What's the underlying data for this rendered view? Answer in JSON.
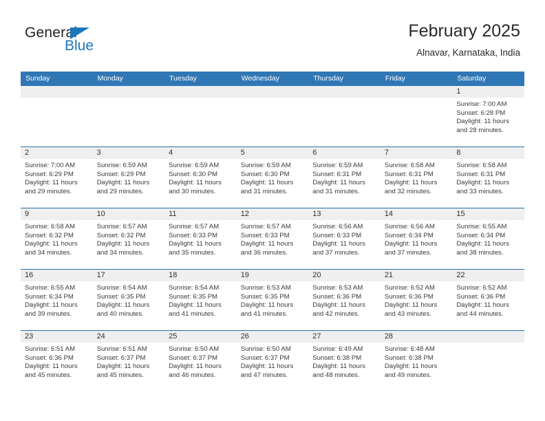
{
  "brand": {
    "name_dark": "General",
    "name_blue": "Blue",
    "accent_color": "#1b76bc"
  },
  "header": {
    "title": "February 2025",
    "subtitle": "Alnavar, Karnataka, India",
    "header_bg_color": "#3077b5",
    "daynum_band_color": "#efefef"
  },
  "weekday_headers": [
    "Sunday",
    "Monday",
    "Tuesday",
    "Wednesday",
    "Thursday",
    "Friday",
    "Saturday"
  ],
  "weeks": [
    [
      {
        "day": "",
        "empty": true
      },
      {
        "day": "",
        "empty": true
      },
      {
        "day": "",
        "empty": true
      },
      {
        "day": "",
        "empty": true
      },
      {
        "day": "",
        "empty": true
      },
      {
        "day": "",
        "empty": true
      },
      {
        "day": "1",
        "sunrise": "Sunrise: 7:00 AM",
        "sunset": "Sunset: 6:28 PM",
        "daylight1": "Daylight: 11 hours",
        "daylight2": "and 28 minutes."
      }
    ],
    [
      {
        "day": "2",
        "sunrise": "Sunrise: 7:00 AM",
        "sunset": "Sunset: 6:29 PM",
        "daylight1": "Daylight: 11 hours",
        "daylight2": "and 29 minutes."
      },
      {
        "day": "3",
        "sunrise": "Sunrise: 6:59 AM",
        "sunset": "Sunset: 6:29 PM",
        "daylight1": "Daylight: 11 hours",
        "daylight2": "and 29 minutes."
      },
      {
        "day": "4",
        "sunrise": "Sunrise: 6:59 AM",
        "sunset": "Sunset: 6:30 PM",
        "daylight1": "Daylight: 11 hours",
        "daylight2": "and 30 minutes."
      },
      {
        "day": "5",
        "sunrise": "Sunrise: 6:59 AM",
        "sunset": "Sunset: 6:30 PM",
        "daylight1": "Daylight: 11 hours",
        "daylight2": "and 31 minutes."
      },
      {
        "day": "6",
        "sunrise": "Sunrise: 6:59 AM",
        "sunset": "Sunset: 6:31 PM",
        "daylight1": "Daylight: 11 hours",
        "daylight2": "and 31 minutes."
      },
      {
        "day": "7",
        "sunrise": "Sunrise: 6:58 AM",
        "sunset": "Sunset: 6:31 PM",
        "daylight1": "Daylight: 11 hours",
        "daylight2": "and 32 minutes."
      },
      {
        "day": "8",
        "sunrise": "Sunrise: 6:58 AM",
        "sunset": "Sunset: 6:31 PM",
        "daylight1": "Daylight: 11 hours",
        "daylight2": "and 33 minutes."
      }
    ],
    [
      {
        "day": "9",
        "sunrise": "Sunrise: 6:58 AM",
        "sunset": "Sunset: 6:32 PM",
        "daylight1": "Daylight: 11 hours",
        "daylight2": "and 34 minutes."
      },
      {
        "day": "10",
        "sunrise": "Sunrise: 6:57 AM",
        "sunset": "Sunset: 6:32 PM",
        "daylight1": "Daylight: 11 hours",
        "daylight2": "and 34 minutes."
      },
      {
        "day": "11",
        "sunrise": "Sunrise: 6:57 AM",
        "sunset": "Sunset: 6:33 PM",
        "daylight1": "Daylight: 11 hours",
        "daylight2": "and 35 minutes."
      },
      {
        "day": "12",
        "sunrise": "Sunrise: 6:57 AM",
        "sunset": "Sunset: 6:33 PM",
        "daylight1": "Daylight: 11 hours",
        "daylight2": "and 36 minutes."
      },
      {
        "day": "13",
        "sunrise": "Sunrise: 6:56 AM",
        "sunset": "Sunset: 6:33 PM",
        "daylight1": "Daylight: 11 hours",
        "daylight2": "and 37 minutes."
      },
      {
        "day": "14",
        "sunrise": "Sunrise: 6:56 AM",
        "sunset": "Sunset: 6:34 PM",
        "daylight1": "Daylight: 11 hours",
        "daylight2": "and 37 minutes."
      },
      {
        "day": "15",
        "sunrise": "Sunrise: 6:55 AM",
        "sunset": "Sunset: 6:34 PM",
        "daylight1": "Daylight: 11 hours",
        "daylight2": "and 38 minutes."
      }
    ],
    [
      {
        "day": "16",
        "sunrise": "Sunrise: 6:55 AM",
        "sunset": "Sunset: 6:34 PM",
        "daylight1": "Daylight: 11 hours",
        "daylight2": "and 39 minutes."
      },
      {
        "day": "17",
        "sunrise": "Sunrise: 6:54 AM",
        "sunset": "Sunset: 6:35 PM",
        "daylight1": "Daylight: 11 hours",
        "daylight2": "and 40 minutes."
      },
      {
        "day": "18",
        "sunrise": "Sunrise: 6:54 AM",
        "sunset": "Sunset: 6:35 PM",
        "daylight1": "Daylight: 11 hours",
        "daylight2": "and 41 minutes."
      },
      {
        "day": "19",
        "sunrise": "Sunrise: 6:53 AM",
        "sunset": "Sunset: 6:35 PM",
        "daylight1": "Daylight: 11 hours",
        "daylight2": "and 41 minutes."
      },
      {
        "day": "20",
        "sunrise": "Sunrise: 6:53 AM",
        "sunset": "Sunset: 6:36 PM",
        "daylight1": "Daylight: 11 hours",
        "daylight2": "and 42 minutes."
      },
      {
        "day": "21",
        "sunrise": "Sunrise: 6:52 AM",
        "sunset": "Sunset: 6:36 PM",
        "daylight1": "Daylight: 11 hours",
        "daylight2": "and 43 minutes."
      },
      {
        "day": "22",
        "sunrise": "Sunrise: 6:52 AM",
        "sunset": "Sunset: 6:36 PM",
        "daylight1": "Daylight: 11 hours",
        "daylight2": "and 44 minutes."
      }
    ],
    [
      {
        "day": "23",
        "sunrise": "Sunrise: 6:51 AM",
        "sunset": "Sunset: 6:36 PM",
        "daylight1": "Daylight: 11 hours",
        "daylight2": "and 45 minutes."
      },
      {
        "day": "24",
        "sunrise": "Sunrise: 6:51 AM",
        "sunset": "Sunset: 6:37 PM",
        "daylight1": "Daylight: 11 hours",
        "daylight2": "and 45 minutes."
      },
      {
        "day": "25",
        "sunrise": "Sunrise: 6:50 AM",
        "sunset": "Sunset: 6:37 PM",
        "daylight1": "Daylight: 11 hours",
        "daylight2": "and 46 minutes."
      },
      {
        "day": "26",
        "sunrise": "Sunrise: 6:50 AM",
        "sunset": "Sunset: 6:37 PM",
        "daylight1": "Daylight: 11 hours",
        "daylight2": "and 47 minutes."
      },
      {
        "day": "27",
        "sunrise": "Sunrise: 6:49 AM",
        "sunset": "Sunset: 6:38 PM",
        "daylight1": "Daylight: 11 hours",
        "daylight2": "and 48 minutes."
      },
      {
        "day": "28",
        "sunrise": "Sunrise: 6:48 AM",
        "sunset": "Sunset: 6:38 PM",
        "daylight1": "Daylight: 11 hours",
        "daylight2": "and 49 minutes."
      },
      {
        "day": "",
        "empty": true
      }
    ]
  ]
}
